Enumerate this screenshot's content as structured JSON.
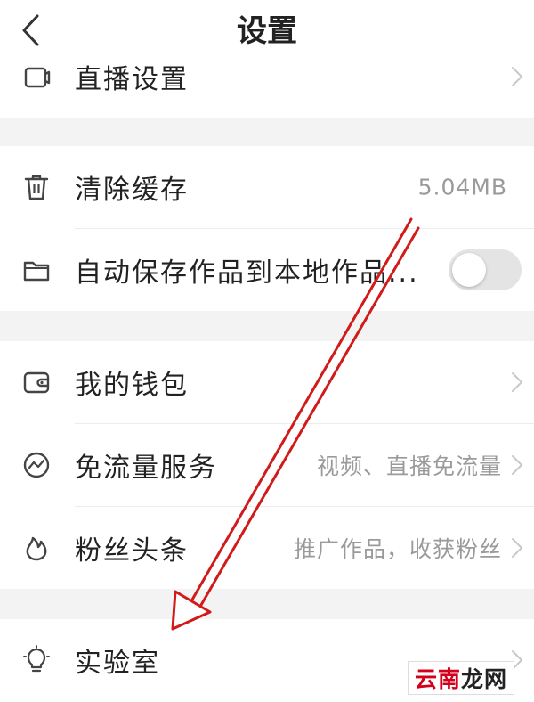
{
  "header": {
    "title": "设置"
  },
  "rows": {
    "live": {
      "label": "直播设置"
    },
    "cache": {
      "label": "清除缓存",
      "value": "5.04MB"
    },
    "autosave": {
      "label": "自动保存作品到本地作品...",
      "toggle_on": false
    },
    "wallet": {
      "label": "我的钱包"
    },
    "traffic": {
      "label": "免流量服务",
      "value": "视频、直播免流量"
    },
    "fans": {
      "label": "粉丝头条",
      "value": "推广作品，收获粉丝"
    },
    "lab": {
      "label": "实验室"
    }
  },
  "colors": {
    "annotation_arrow": "#d11a1a",
    "section_gap": "#f3f3f3",
    "toggle_off": "#e4e4e4"
  },
  "icons": [
    "back-chevron-icon",
    "tv-icon",
    "trash-icon",
    "folder-icon",
    "wallet-icon",
    "traffic-icon",
    "flame-icon",
    "lightbulb-icon",
    "chevron-right-icon"
  ],
  "watermark": {
    "part_a": "云南",
    "part_b": "龙网"
  }
}
